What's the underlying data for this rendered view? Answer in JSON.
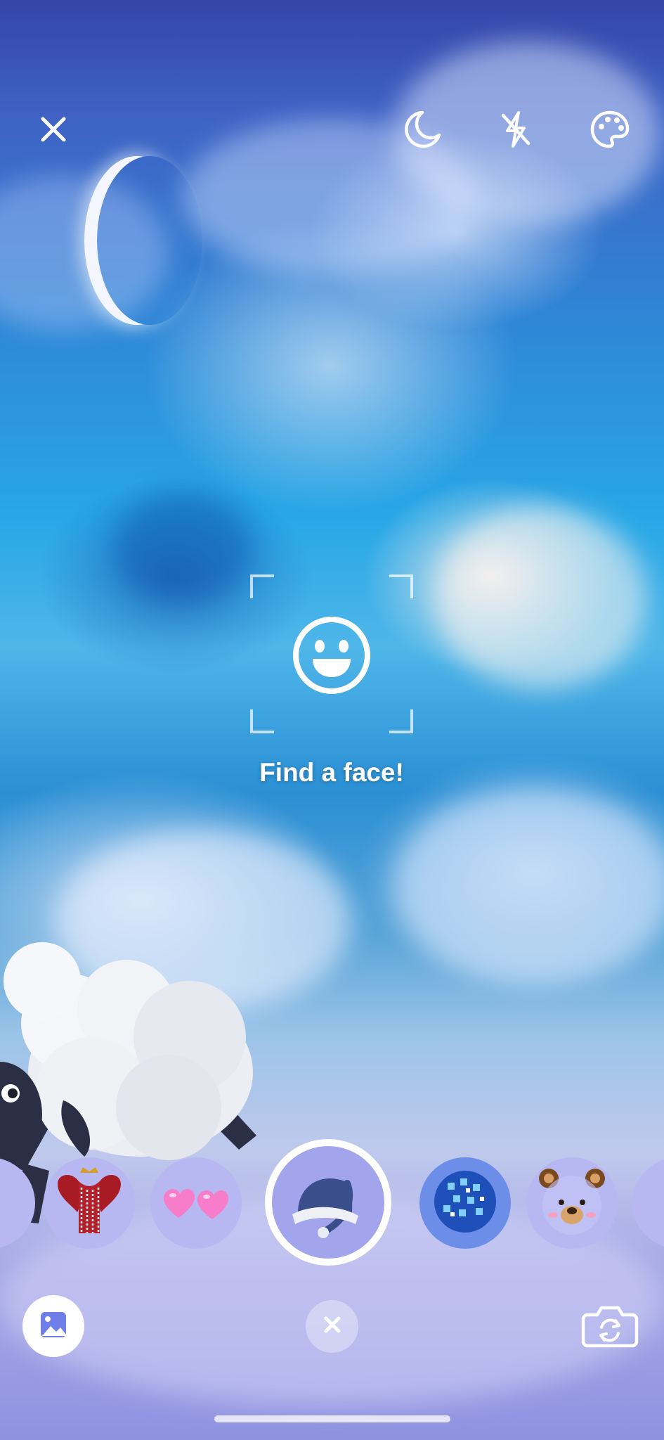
{
  "top_bar": {
    "close_icon": "close-icon",
    "night_mode_icon": "moon-icon",
    "flash_icon": "flash-off-icon",
    "effects_icon": "palette-icon"
  },
  "face_finder": {
    "icon": "smiley-face-icon",
    "hint": "Find a face!"
  },
  "filter_carousel": {
    "items": [
      {
        "name": "royal-hearts-crown-filter",
        "icon": "crown-hearts-icon"
      },
      {
        "name": "pink-hearts-filter",
        "icon": "pink-hearts-icon"
      },
      {
        "name": "sleep-cap-filter",
        "icon": "night-cap-icon",
        "selected": true
      },
      {
        "name": "disco-ball-filter",
        "icon": "disco-ball-icon"
      },
      {
        "name": "bear-filter",
        "icon": "bear-face-icon"
      }
    ]
  },
  "bottom_bar": {
    "gallery_icon": "image-icon",
    "clear_icon": "close-icon",
    "flip_camera_icon": "camera-flip-icon"
  },
  "colors": {
    "sky_top": "#3446a8",
    "sky_mid": "#28a7e6",
    "sky_bottom": "#8f92e0",
    "button_white": "#ffffff",
    "carousel_bg": "#b7b8f1"
  }
}
